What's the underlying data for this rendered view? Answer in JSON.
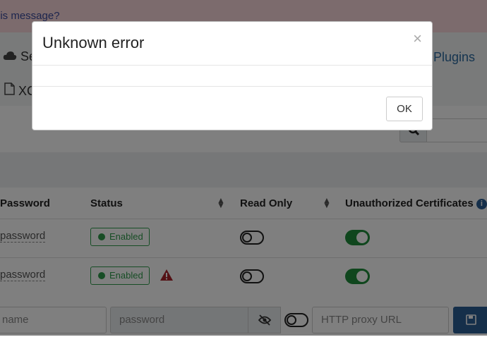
{
  "background": {
    "alert_text": "his message?",
    "nav": {
      "plugins": "Plugins",
      "se_partial": "Se",
      "xc_partial": "XC"
    },
    "table": {
      "headers": {
        "password": "Password",
        "status": "Status",
        "read_only": "Read Only",
        "unauthorized_certificates": "Unauthorized Certificates"
      },
      "rows": [
        {
          "password": "password",
          "status": "Enabled",
          "read_only": false,
          "unauthorized_certificates": true,
          "warning": false
        },
        {
          "password": "password",
          "status": "Enabled",
          "read_only": false,
          "unauthorized_certificates": true,
          "warning": true
        }
      ]
    },
    "new_row": {
      "name_placeholder": "name",
      "password_placeholder": "password",
      "proxy_placeholder": "HTTP proxy URL"
    },
    "colors": {
      "enabled_green": "#2e9a4b",
      "toggle_on": "#1f8d3a",
      "warning_red": "#a8232a",
      "save_blue": "#2a5f95",
      "alert_bg": "#f8d7da"
    }
  },
  "modal": {
    "title": "Unknown error",
    "close_icon": "×",
    "body": "",
    "ok_label": "OK"
  }
}
